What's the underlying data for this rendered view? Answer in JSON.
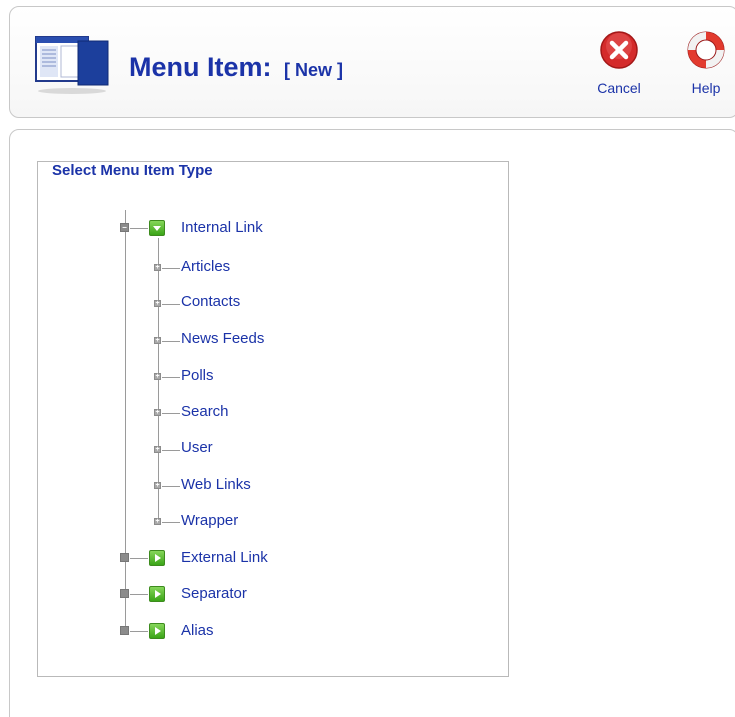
{
  "header": {
    "title": "Menu Item:",
    "title_tag": "[ New ]",
    "icon": "menu-icon"
  },
  "toolbar": {
    "cancel": {
      "label": "Cancel",
      "icon": "cancel-icon",
      "color": "#d42b2b"
    },
    "help": {
      "label": "Help",
      "icon": "help-icon",
      "color": "#e23a2e"
    }
  },
  "panel": {
    "legend": "Select Menu Item Type"
  },
  "tree": {
    "internal": {
      "label": "Internal Link",
      "children": [
        "Articles",
        "Contacts",
        "News Feeds",
        "Polls",
        "Search",
        "User",
        "Web Links",
        "Wrapper"
      ]
    },
    "others": [
      "External Link",
      "Separator",
      "Alias"
    ]
  },
  "colors": {
    "link": "#1b33a8",
    "green_icon": "#4cb825"
  }
}
